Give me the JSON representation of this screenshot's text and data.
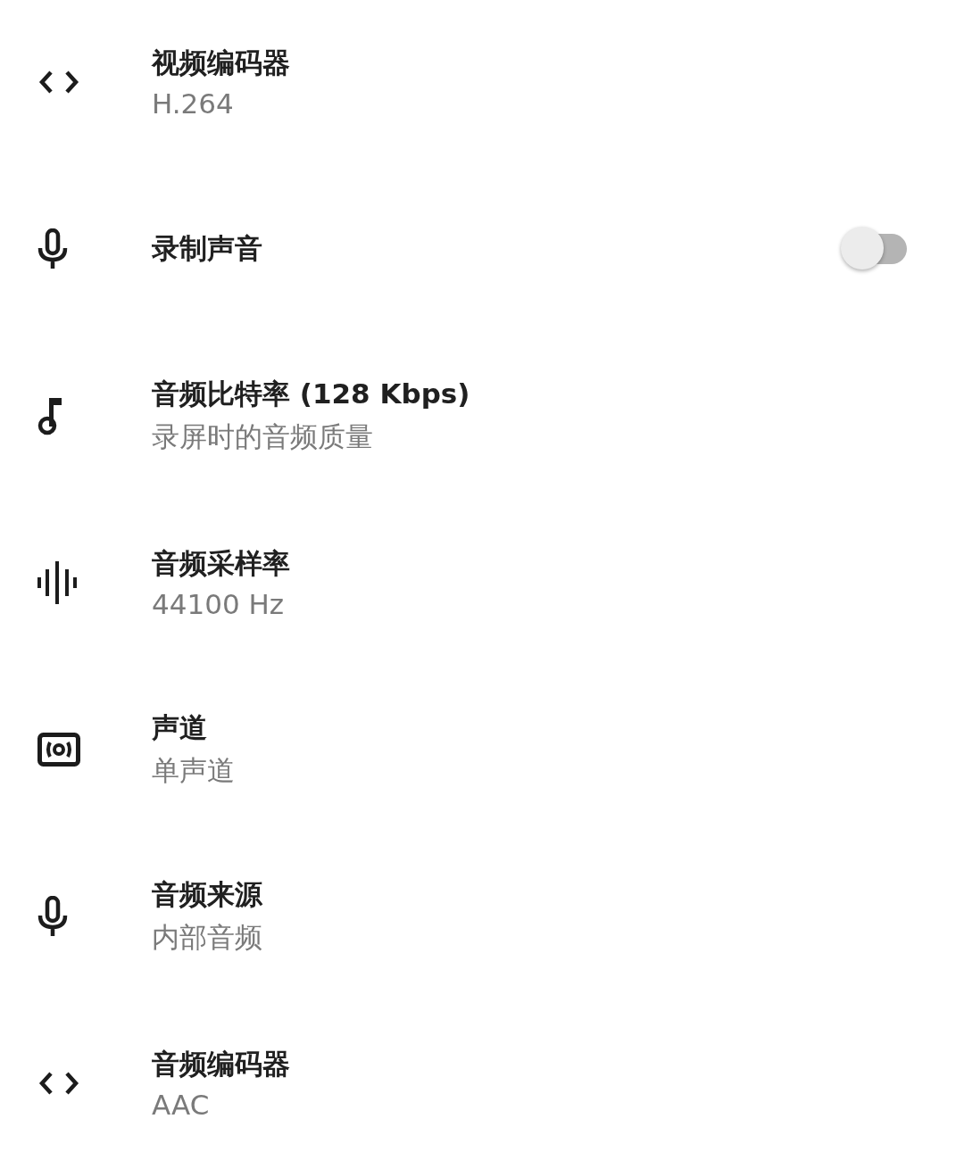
{
  "settings": [
    {
      "kind": "value",
      "title": "视频编码器",
      "summary": "H.264"
    },
    {
      "kind": "toggle",
      "title": "录制声音",
      "on": false
    },
    {
      "kind": "value",
      "title": "音频比特率 (128 Kbps)",
      "summary": "录屏时的音频质量"
    },
    {
      "kind": "value",
      "title": "音频采样率",
      "summary": "44100 Hz"
    },
    {
      "kind": "value",
      "title": "声道",
      "summary": "单声道"
    },
    {
      "kind": "value",
      "title": "音频来源",
      "summary": "内部音频"
    },
    {
      "kind": "value",
      "title": "音频编码器",
      "summary": "AAC"
    }
  ]
}
